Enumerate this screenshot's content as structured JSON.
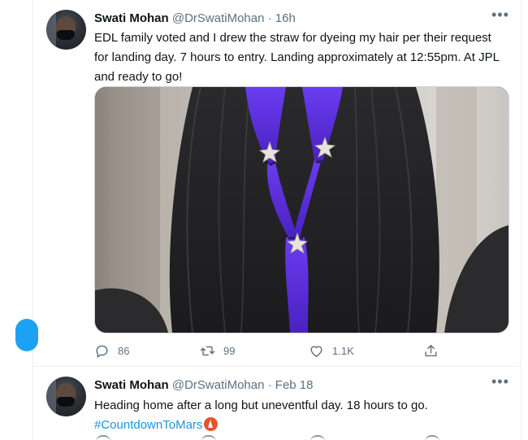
{
  "tweets": [
    {
      "name": "Swati Mohan",
      "handle": "@DrSwatiMohan",
      "separator": "·",
      "time": "16h",
      "text": "EDL family voted and I drew the straw for dyeing my hair per their request for landing day. 7 hours to entry.  Landing approximately at 12:55pm.  At JPL and ready to go!",
      "actions": {
        "reply_count": "86",
        "retweet_count": "99",
        "like_count": "1.1K"
      },
      "icons": [
        "reply-icon",
        "retweet-icon",
        "like-icon",
        "share-icon",
        "more-icon"
      ]
    },
    {
      "name": "Swati Mohan",
      "handle": "@DrSwatiMohan",
      "separator": "·",
      "time": "Feb 18",
      "text": "Heading home after a long but uneventful day.  18 hours to go.",
      "hashtag": "#CountdownToMars",
      "emoji": "rocket-badge-icon"
    }
  ],
  "colors": {
    "link": "#1b95e0",
    "secondary_text": "#5b7083",
    "purple_hair": "#5a2fd6",
    "accent_blue": "#1da1f2"
  }
}
